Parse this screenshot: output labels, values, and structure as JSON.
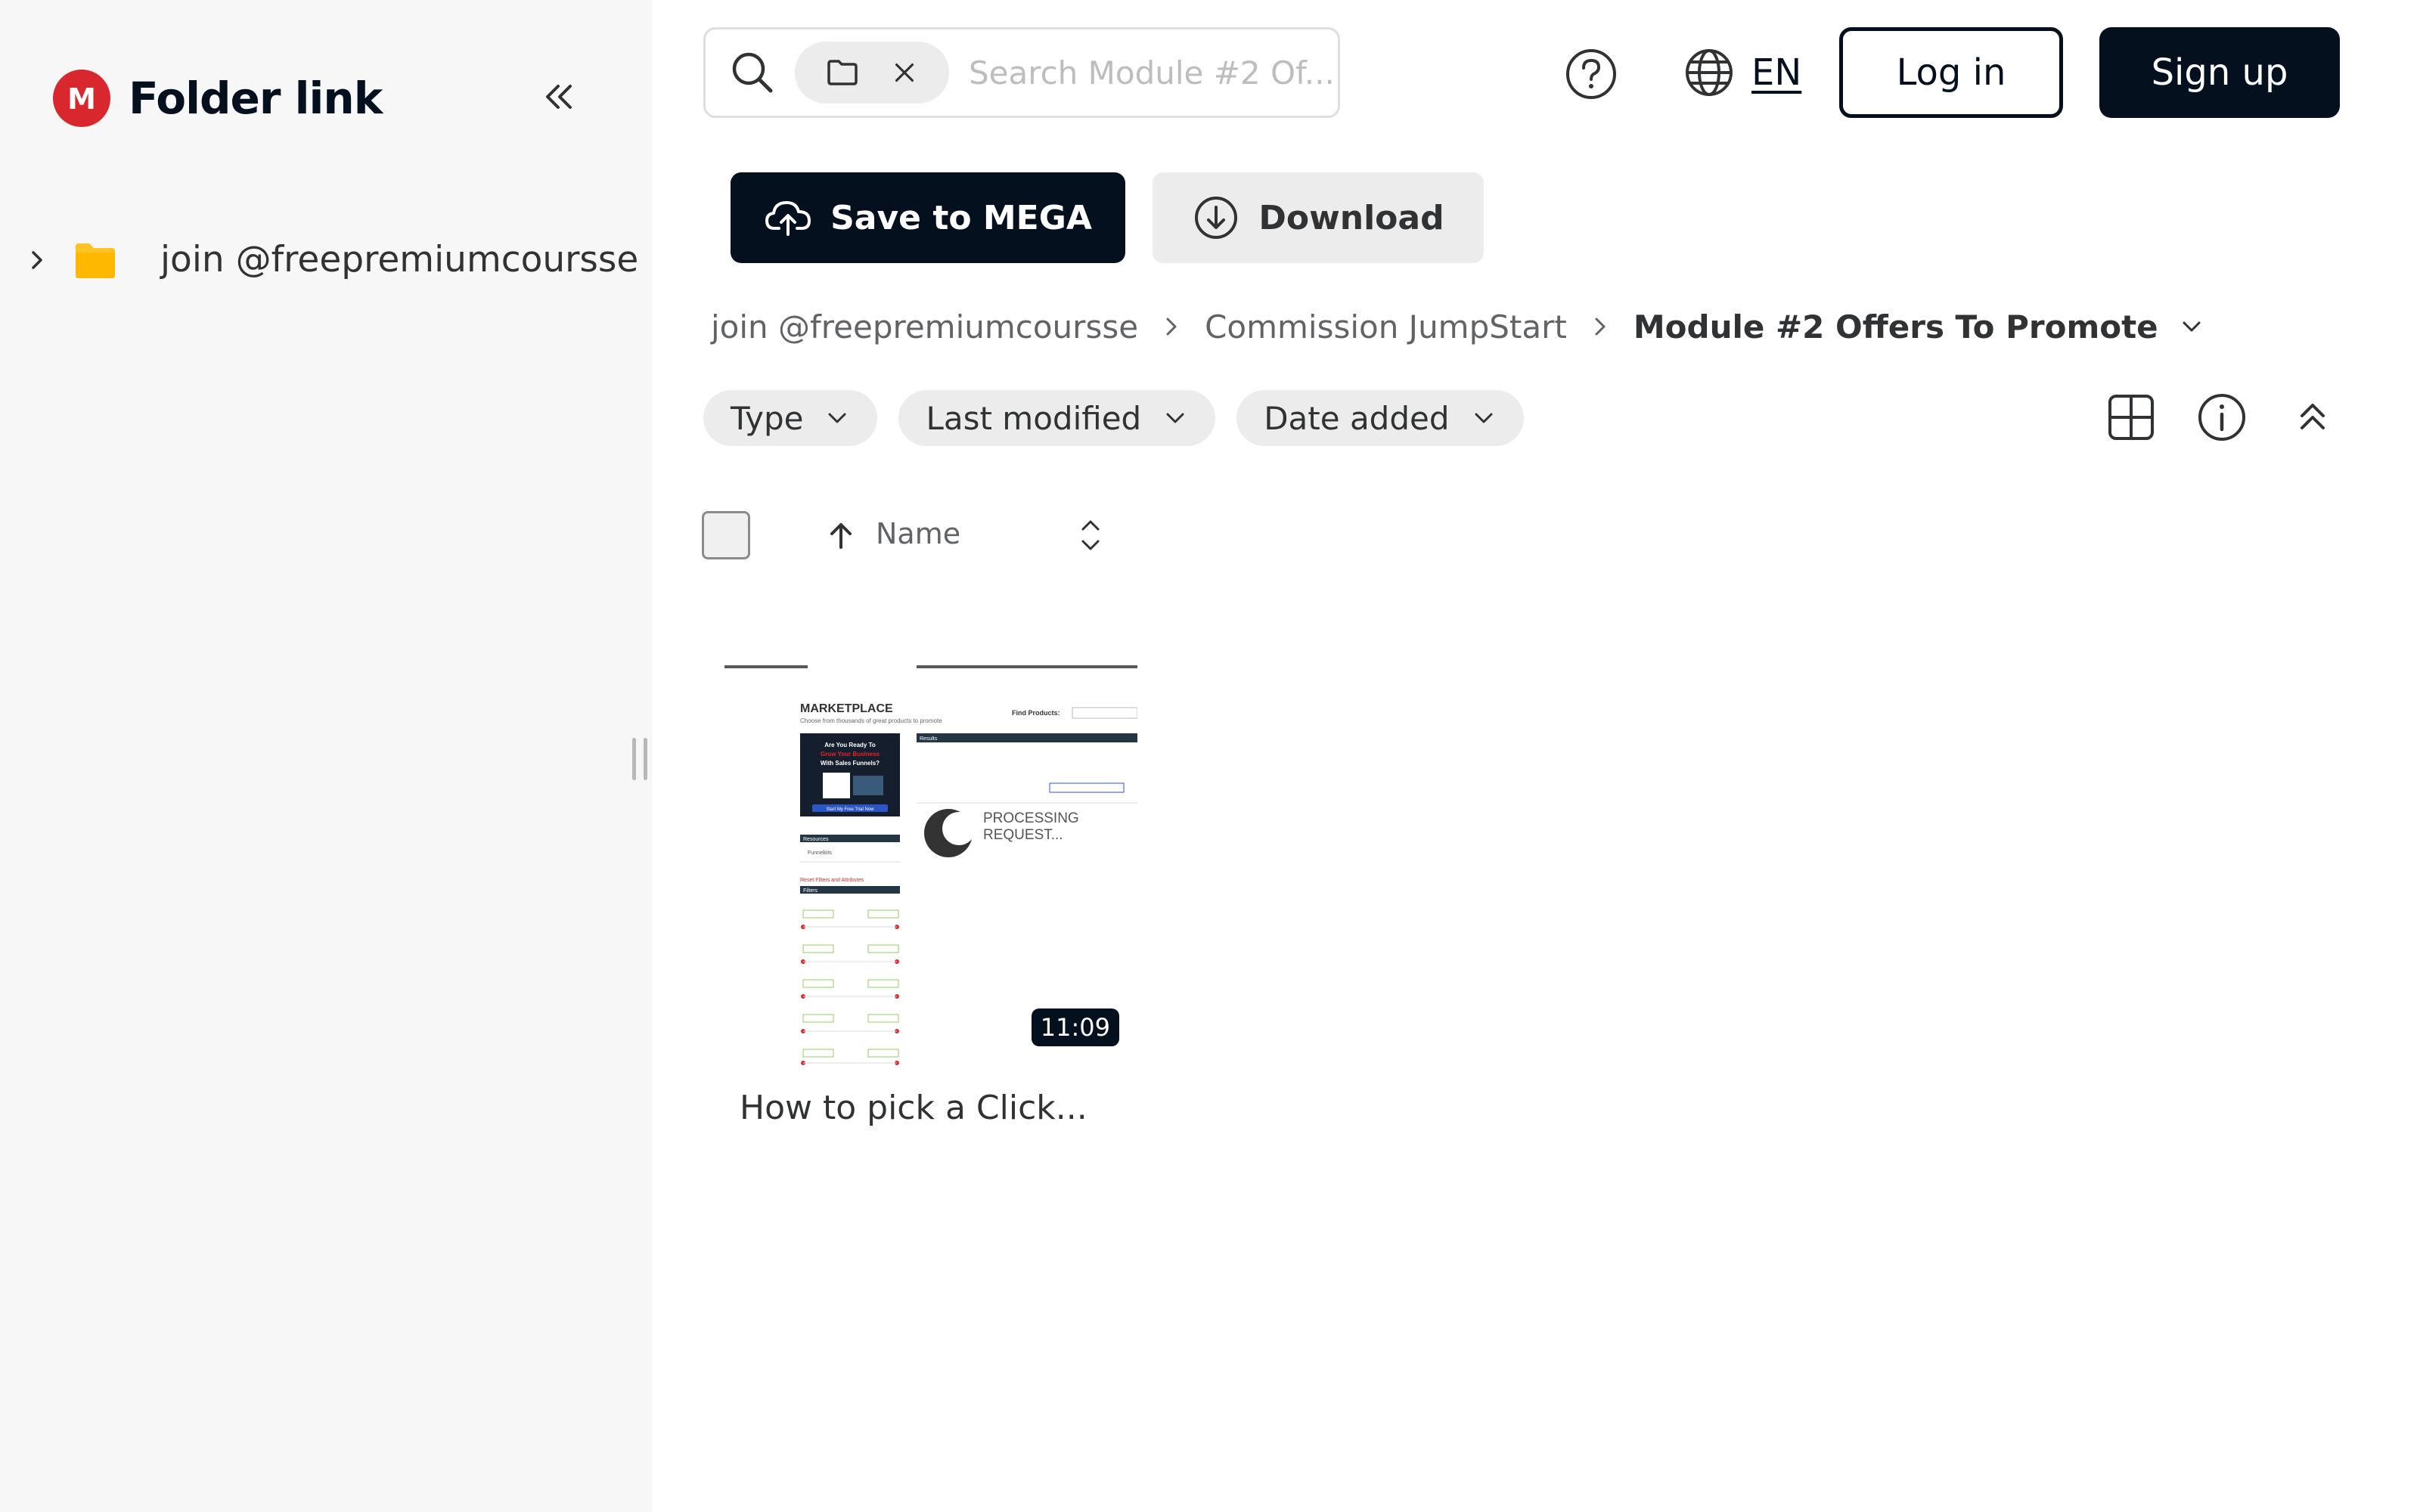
{
  "sidebar": {
    "brand_glyph": "M",
    "brand_title": "Folder link",
    "tree_item_label": "join @freepremiumcoursse",
    "icons": {
      "logo": "mega-logo-icon",
      "collapse": "double-chevron-left-icon",
      "expand": "chevron-right-icon",
      "folder": "folder-icon"
    },
    "colors": {
      "brand_red": "#d9272e",
      "folder_yellow": "#ffc424"
    }
  },
  "topbar": {
    "search_placeholder": "Search Module #2 Of...",
    "language": "EN",
    "login_label": "Log in",
    "signup_label": "Sign up",
    "icons": {
      "search": "search-icon",
      "help": "help-circle-icon",
      "language": "globe-icon"
    }
  },
  "actions": {
    "save_label": "Save to MEGA",
    "download_label": "Download"
  },
  "breadcrumb": {
    "items": [
      "join @freepremiumcoursse",
      "Commission JumpStart"
    ],
    "current": "Module #2 Offers To Promote"
  },
  "filters": {
    "type": "Type",
    "last_modified": "Last modified",
    "date_added": "Date added"
  },
  "list_header": {
    "sort_label": "Name"
  },
  "files": [
    {
      "name": "How to pick a Click...",
      "duration": "11:09",
      "thumbnail": {
        "marketplace": "MARKETPLACE",
        "subtitle": "Choose from thousands of great products to promote",
        "find": "Find Products:",
        "ad_text": "Are You Ready To Grow Your Business With Sales Funnels?",
        "ad_button": "Start My Free Trial Now",
        "resources": "Resources",
        "funnelkits": "Funnelkits",
        "filters": "Filters",
        "results": "Results",
        "processing_1": "PROCESSING",
        "processing_2": "REQUEST..."
      }
    }
  ],
  "colors": {
    "primary_dark": "#04101e",
    "chip_gray": "#ececec",
    "sidebar_bg": "#f7f7f7"
  }
}
